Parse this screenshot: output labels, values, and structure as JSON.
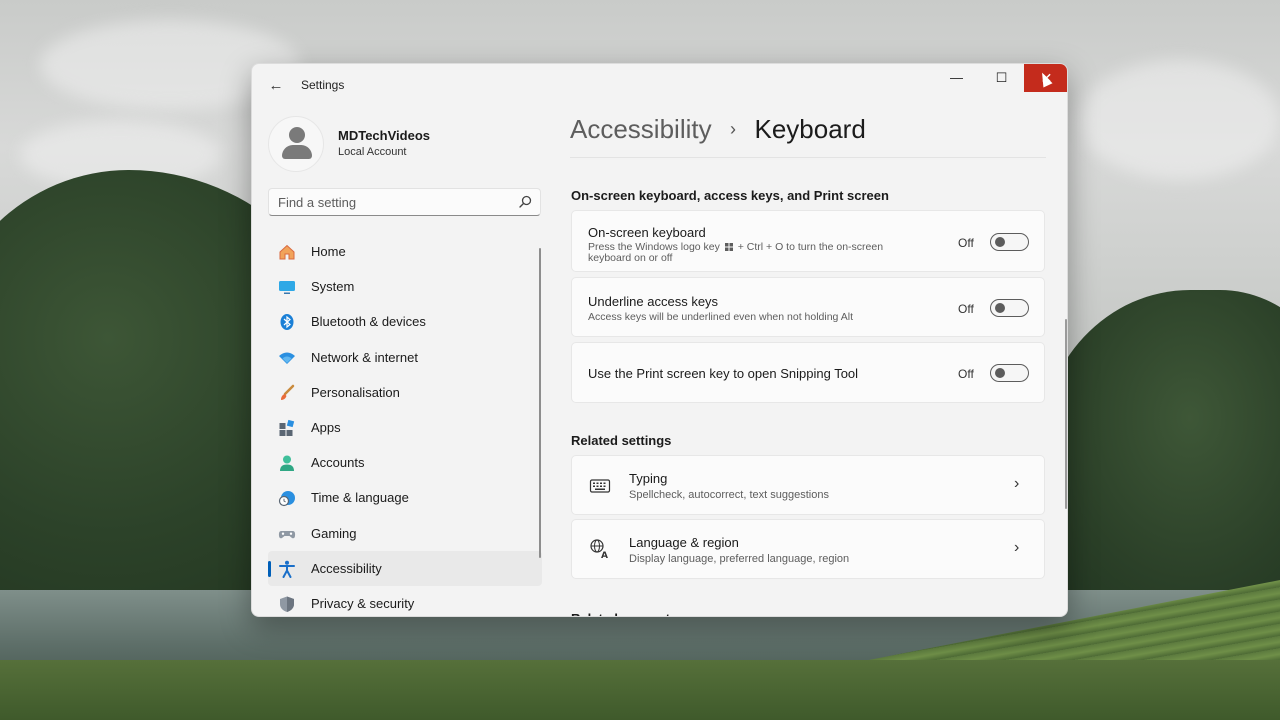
{
  "window": {
    "app_title": "Settings",
    "back_icon": "arrow-left-icon",
    "controls": {
      "minimize": "—",
      "maximize": "☐",
      "close": "✕"
    }
  },
  "profile": {
    "name": "MDTechVideos",
    "account_type": "Local Account"
  },
  "search": {
    "placeholder": "Find a setting"
  },
  "nav": {
    "items": [
      {
        "label": "Home",
        "icon": "home-icon"
      },
      {
        "label": "System",
        "icon": "display-icon"
      },
      {
        "label": "Bluetooth & devices",
        "icon": "bluetooth-icon"
      },
      {
        "label": "Network & internet",
        "icon": "wifi-icon"
      },
      {
        "label": "Personalisation",
        "icon": "brush-icon"
      },
      {
        "label": "Apps",
        "icon": "apps-icon"
      },
      {
        "label": "Accounts",
        "icon": "person-icon"
      },
      {
        "label": "Time & language",
        "icon": "clock-globe-icon"
      },
      {
        "label": "Gaming",
        "icon": "gamepad-icon"
      },
      {
        "label": "Accessibility",
        "icon": "accessibility-icon",
        "active": true
      },
      {
        "label": "Privacy & security",
        "icon": "shield-icon"
      }
    ]
  },
  "breadcrumb": {
    "parent": "Accessibility",
    "separator": "›",
    "current": "Keyboard"
  },
  "sections": {
    "keyboard": {
      "title": "On-screen keyboard, access keys, and Print screen",
      "settings": [
        {
          "title": "On-screen keyboard",
          "desc_before": "Press the Windows logo key",
          "desc_after": "+ Ctrl + O to turn the on-screen",
          "desc_line2": "keyboard on or off",
          "state": "Off"
        },
        {
          "title": "Underline access keys",
          "desc": "Access keys will be underlined even when not holding Alt",
          "state": "Off"
        },
        {
          "title": "Use the Print screen key to open Snipping Tool",
          "state": "Off"
        }
      ]
    },
    "related": {
      "title": "Related settings",
      "links": [
        {
          "title": "Typing",
          "desc": "Spellcheck, autocorrect, text suggestions",
          "icon": "keyboard-icon"
        },
        {
          "title": "Language & region",
          "desc": "Display language, preferred language, region",
          "icon": "language-icon"
        }
      ]
    },
    "support": {
      "title": "Related support"
    }
  },
  "colors": {
    "accent": "#005fb8",
    "close": "#c42b1c",
    "window_bg": "#f3f3f3",
    "card_bg": "#fbfbfb"
  }
}
